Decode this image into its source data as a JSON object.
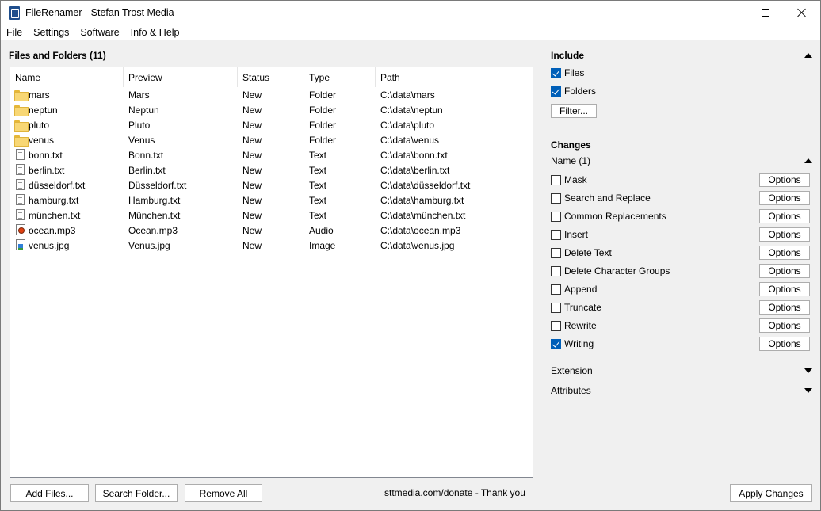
{
  "window": {
    "title": "FileRenamer - Stefan Trost Media"
  },
  "menu": [
    "File",
    "Settings",
    "Software",
    "Info & Help"
  ],
  "files_panel": {
    "heading": "Files and Folders (11)",
    "columns": [
      "Name",
      "Preview",
      "Status",
      "Type",
      "Path"
    ],
    "rows": [
      {
        "icon": "folder-icon",
        "name": "mars",
        "preview": "Mars",
        "status": "New",
        "type": "Folder",
        "path": "C:\\data\\mars"
      },
      {
        "icon": "folder-icon",
        "name": "neptun",
        "preview": "Neptun",
        "status": "New",
        "type": "Folder",
        "path": "C:\\data\\neptun"
      },
      {
        "icon": "folder-icon",
        "name": "pluto",
        "preview": "Pluto",
        "status": "New",
        "type": "Folder",
        "path": "C:\\data\\pluto"
      },
      {
        "icon": "folder-icon",
        "name": "venus",
        "preview": "Venus",
        "status": "New",
        "type": "Folder",
        "path": "C:\\data\\venus"
      },
      {
        "icon": "text-file-icon",
        "name": "bonn.txt",
        "preview": "Bonn.txt",
        "status": "New",
        "type": "Text",
        "path": "C:\\data\\bonn.txt"
      },
      {
        "icon": "text-file-icon",
        "name": "berlin.txt",
        "preview": "Berlin.txt",
        "status": "New",
        "type": "Text",
        "path": "C:\\data\\berlin.txt"
      },
      {
        "icon": "text-file-icon",
        "name": "düsseldorf.txt",
        "preview": "Düsseldorf.txt",
        "status": "New",
        "type": "Text",
        "path": "C:\\data\\düsseldorf.txt"
      },
      {
        "icon": "text-file-icon",
        "name": "hamburg.txt",
        "preview": "Hamburg.txt",
        "status": "New",
        "type": "Text",
        "path": "C:\\data\\hamburg.txt"
      },
      {
        "icon": "text-file-icon",
        "name": "münchen.txt",
        "preview": "München.txt",
        "status": "New",
        "type": "Text",
        "path": "C:\\data\\münchen.txt"
      },
      {
        "icon": "audio-file-icon",
        "name": "ocean.mp3",
        "preview": "Ocean.mp3",
        "status": "New",
        "type": "Audio",
        "path": "C:\\data\\ocean.mp3"
      },
      {
        "icon": "image-file-icon",
        "name": "venus.jpg",
        "preview": "Venus.jpg",
        "status": "New",
        "type": "Image",
        "path": "C:\\data\\venus.jpg"
      }
    ]
  },
  "bottom": {
    "add_files": "Add Files...",
    "search_folder": "Search Folder...",
    "remove_all": "Remove All",
    "donate": "sttmedia.com/donate - Thank you",
    "apply_changes": "Apply Changes"
  },
  "include": {
    "heading": "Include",
    "files_label": "Files",
    "files_checked": true,
    "folders_label": "Folders",
    "folders_checked": true,
    "filter_button": "Filter..."
  },
  "changes": {
    "heading": "Changes",
    "name_section": "Name (1)",
    "options_label": "Options",
    "items": [
      {
        "label": "Mask",
        "checked": false
      },
      {
        "label": "Search and Replace",
        "checked": false
      },
      {
        "label": "Common Replacements",
        "checked": false
      },
      {
        "label": "Insert",
        "checked": false
      },
      {
        "label": "Delete Text",
        "checked": false
      },
      {
        "label": "Delete Character Groups",
        "checked": false
      },
      {
        "label": "Append",
        "checked": false
      },
      {
        "label": "Truncate",
        "checked": false
      },
      {
        "label": "Rewrite",
        "checked": false
      },
      {
        "label": "Writing",
        "checked": true
      }
    ],
    "extension_section": "Extension",
    "attributes_section": "Attributes"
  },
  "colors": {
    "checkbox_checked": "#005fb8",
    "folder_yellow": "#f8d775",
    "window_bg": "#f0f0f0"
  }
}
